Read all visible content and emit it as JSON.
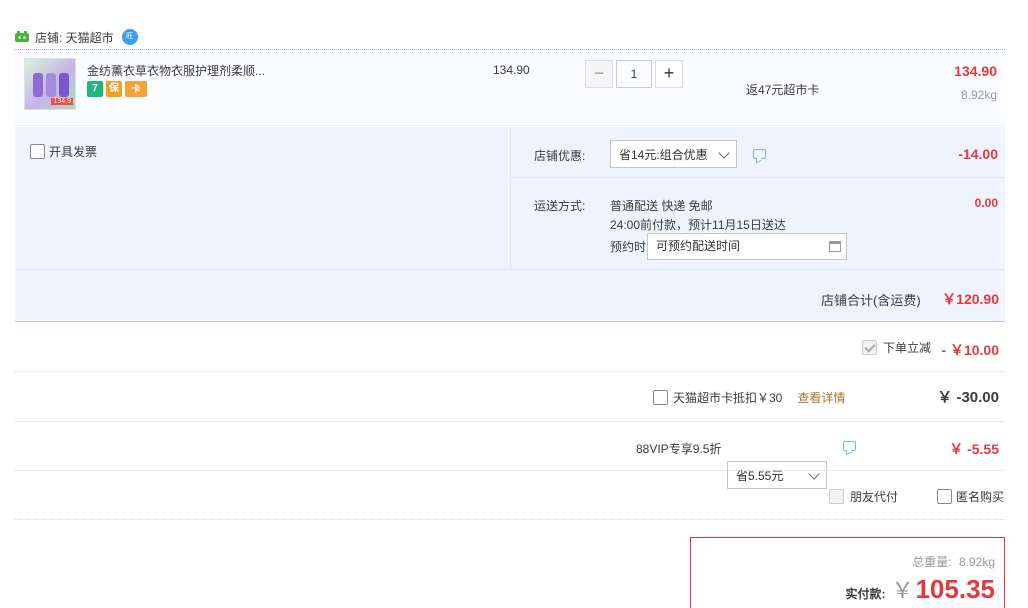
{
  "shop": {
    "label": "店铺: 天猫超市",
    "contact_badge": "旺",
    "icon": "tmall-shop-icon"
  },
  "item": {
    "title": "金纺薰衣草衣物衣服护理剂柔顺...",
    "unit_price": "134.90",
    "quantity": "1",
    "rebate": "返47元超市卡",
    "subtotal": "134.90",
    "weight": "8.92kg",
    "thumb_tag": "134.9",
    "badges": [
      "7",
      "保",
      "卡"
    ]
  },
  "service": {
    "invoice_label": "开具发票",
    "discount_label": "店铺优惠:",
    "discount_select": "省14元:组合优惠",
    "discount_amount": "-14.00",
    "shipping_label": "运送方式:",
    "shipping_method": "普通配送 快递 免邮",
    "shipping_eta": "24:00前付款，预计11月15日送达",
    "schedule_label": "预约时间",
    "schedule_placeholder": "可预约配送时间",
    "shipping_amount": "0.00",
    "shop_total_label": "店铺合计(含运费)",
    "shop_total": "￥120.90"
  },
  "promos": {
    "instant_label": "下单立减",
    "instant_amount": "- ￥10.00",
    "card_label": "天猫超市卡抵扣￥30",
    "card_link": "查看详情",
    "card_amount": "￥ -30.00",
    "vip_label": "88VIP专享9.5折",
    "vip_select": "省5.55元",
    "vip_amount": "￥ -5.55",
    "friend_pay": "朋友代付",
    "anonymous": "匿名购买"
  },
  "summary": {
    "weight_label": "总重量:",
    "weight_value": "8.92kg",
    "pay_label": "实付款:",
    "currency": "￥",
    "pay_amount": "105.35"
  },
  "colors": {
    "price_red": "#e4393c",
    "link_brown": "#a9782f",
    "panel_blue": "#eef3fd"
  }
}
